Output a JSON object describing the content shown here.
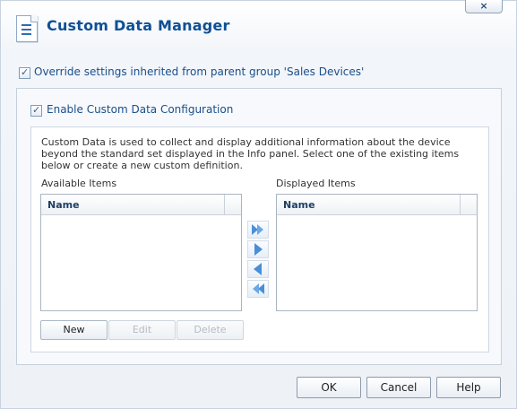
{
  "window": {
    "title": "Custom Data Manager",
    "close_label": "×"
  },
  "override": {
    "checked": true,
    "label": "Override settings inherited from parent group 'Sales Devices'"
  },
  "enable": {
    "checked": true,
    "label": "Enable Custom Data Configuration"
  },
  "description": "Custom Data is used to collect and display additional information about the device beyond the standard set displayed in the Info panel. Select one of the existing items below or create a new custom definition.",
  "available": {
    "label": "Available Items",
    "column": "Name",
    "items": []
  },
  "displayed": {
    "label": "Displayed Items",
    "column": "Name",
    "items": []
  },
  "transfer": [
    "move-all-right-icon",
    "move-right-icon",
    "move-left-icon",
    "move-all-left-icon"
  ],
  "actions": {
    "new": "New",
    "edit": "Edit",
    "delete": "Delete"
  },
  "footer": {
    "ok": "OK",
    "cancel": "Cancel",
    "help": "Help"
  },
  "colors": {
    "title": "#0f5096",
    "arrow": "#4a8fd6"
  }
}
